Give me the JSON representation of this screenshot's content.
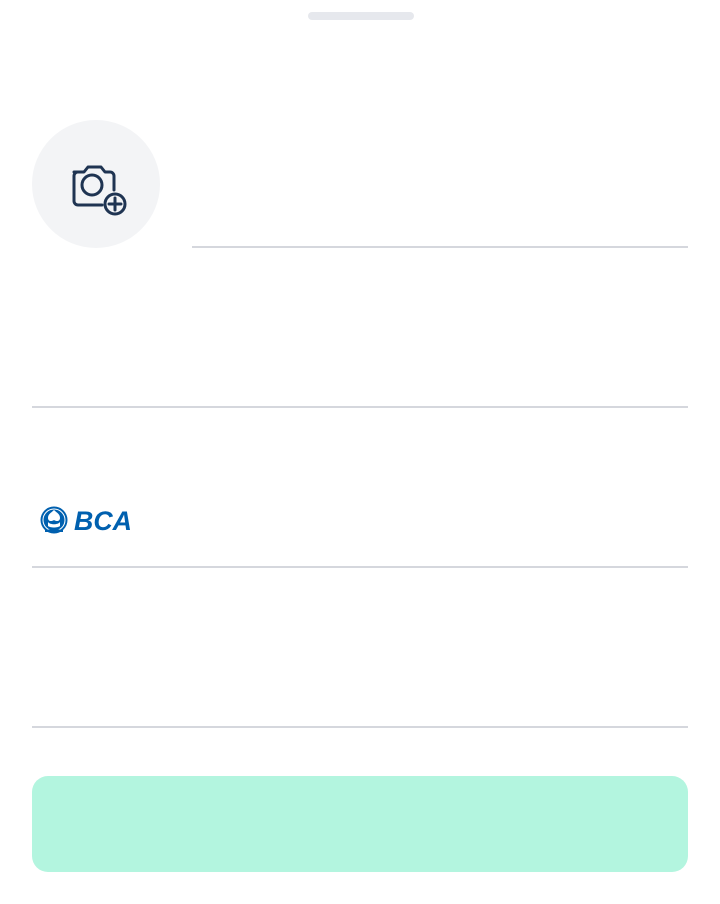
{
  "sheet": {
    "handle": "drag-handle"
  },
  "profile": {
    "photo_icon": "camera-add-icon",
    "name_value": ""
  },
  "form": {
    "field2_value": "",
    "bank": {
      "logo": "BCA",
      "value": ""
    },
    "field4_value": ""
  },
  "actions": {
    "submit_label": ""
  },
  "colors": {
    "icon": "#1f3452",
    "photo_bg": "#f3f4f6",
    "divider": "#d5d7dd",
    "submit_bg": "#b3f5df",
    "bca_blue": "#0060af"
  }
}
